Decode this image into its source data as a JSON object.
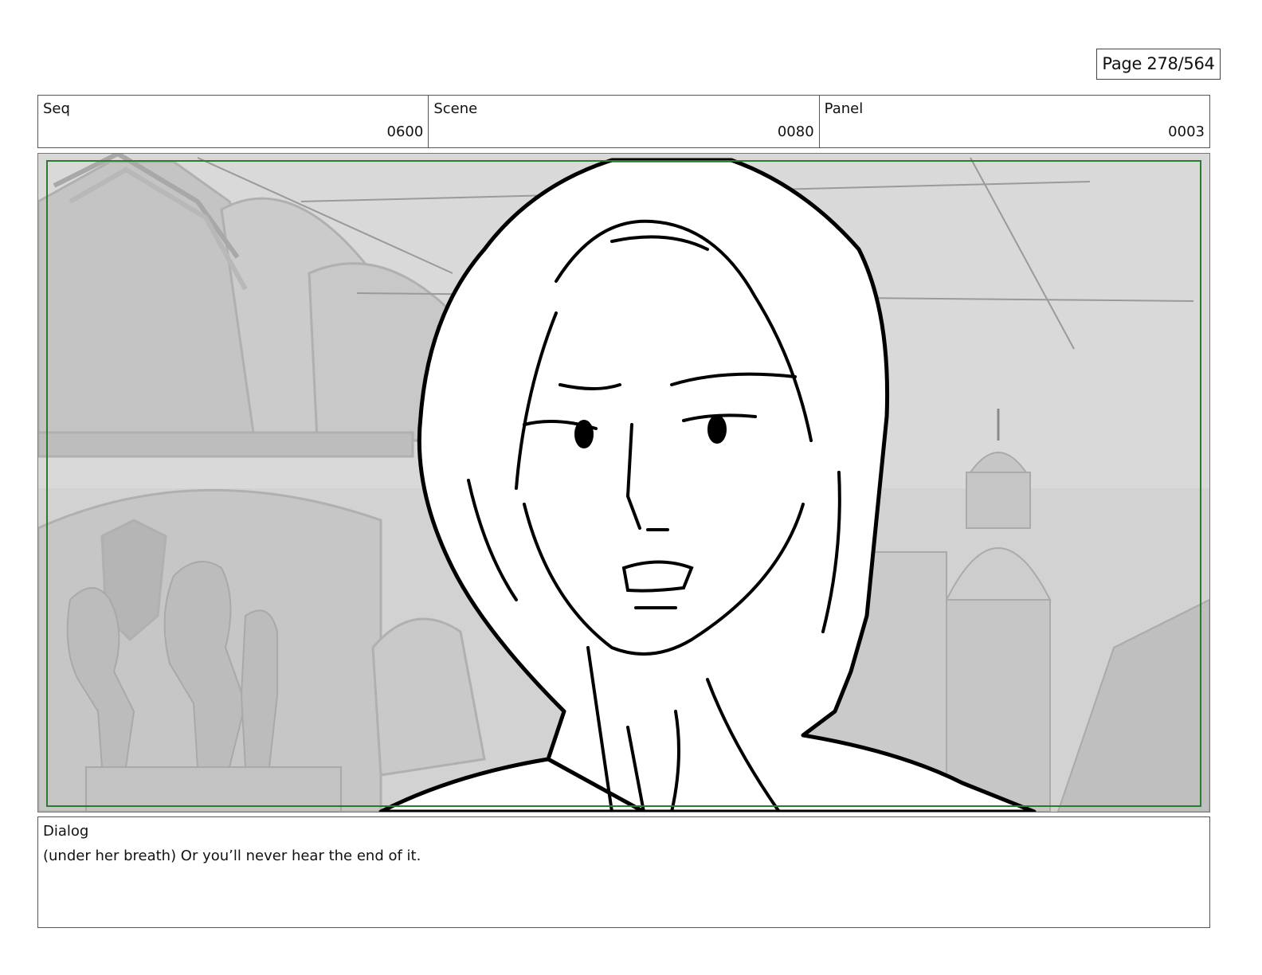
{
  "page": {
    "label": "Page 278/564"
  },
  "header": {
    "seq": {
      "label": "Seq",
      "value": "0600"
    },
    "scene": {
      "label": "Scene",
      "value": "0080"
    },
    "panel": {
      "label": "Panel",
      "value": "0003"
    }
  },
  "dialog": {
    "label": "Dialog",
    "text": "(under her breath) Or you’ll never hear the end of it."
  },
  "colors": {
    "safe_frame": "#2c7a2c",
    "background_tone": "#cfcfcf",
    "line_art": "#000000"
  }
}
